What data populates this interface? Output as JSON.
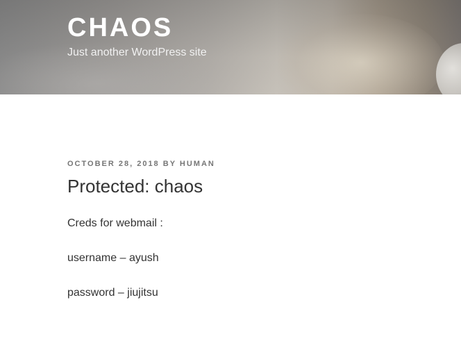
{
  "header": {
    "site_title": "CHAOS",
    "site_description": "Just another WordPress site"
  },
  "post": {
    "date": "OCTOBER 28, 2018",
    "by": "BY",
    "author": "HUMAN",
    "title": "Protected: chaos",
    "paragraphs": [
      "Creds for webmail :",
      "username – ayush",
      "password – jiujitsu"
    ]
  }
}
